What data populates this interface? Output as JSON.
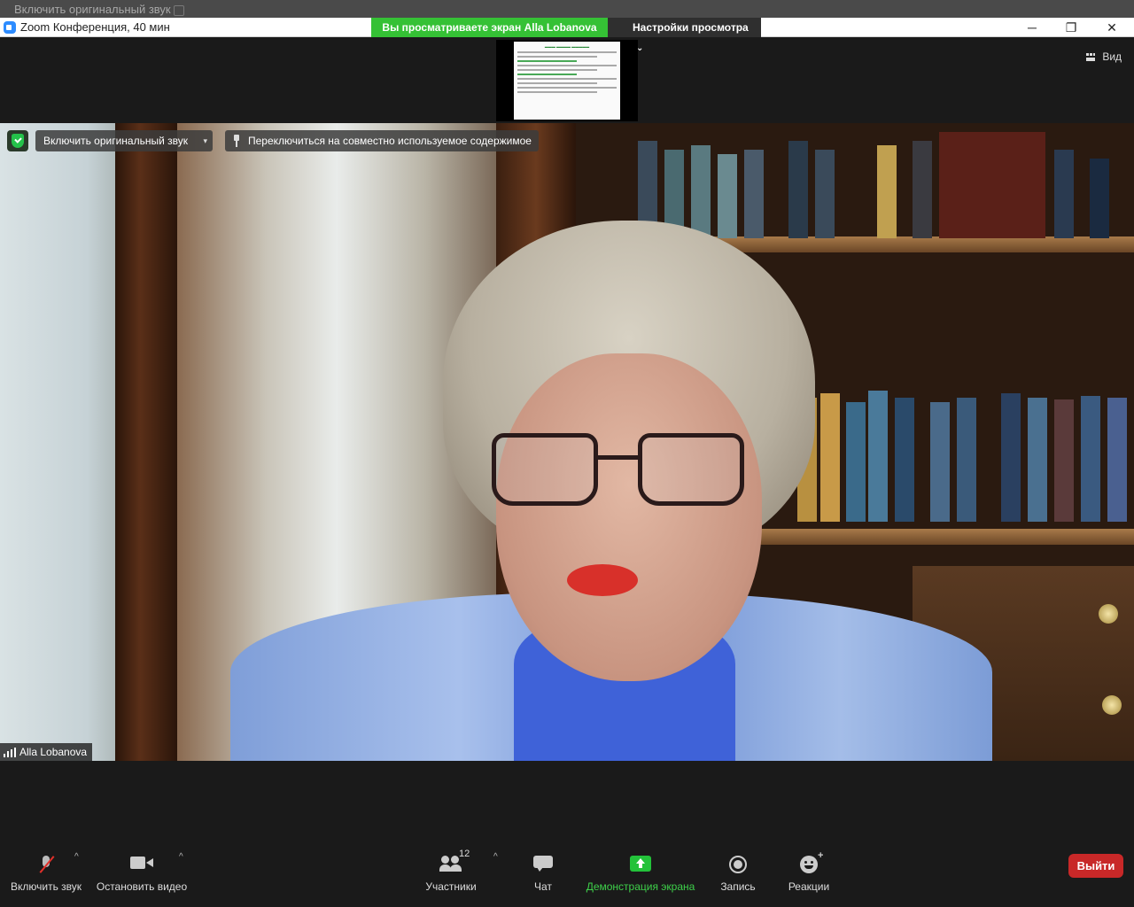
{
  "ghost": {
    "text": "Включить оригинальный звук"
  },
  "titlebar": {
    "title": "Zoom Конференция, 40 мин",
    "minimize": "─",
    "restore": "❐",
    "close": "✕"
  },
  "share_banner": {
    "viewing": "Вы просматриваете экран Alla Lobanova",
    "view_settings": "Настройки просмотра",
    "chevron": "⌄"
  },
  "view_button": {
    "label": "Вид"
  },
  "video_overlay": {
    "original_sound": "Включить оригинальный звук",
    "original_sound_dropdown": "▾",
    "switch_to_shared": "Переключиться на совместно используемое содержимое",
    "participant_name": "Alla Lobanova"
  },
  "toolbar": {
    "unmute": "Включить звук",
    "stop_video": "Остановить видео",
    "participants": "Участники",
    "participants_count": "12",
    "chat": "Чат",
    "share_screen": "Демонстрация экрана",
    "record": "Запись",
    "reactions": "Реакции",
    "caret": "^",
    "plus": "+",
    "leave": "Выйти"
  },
  "colors": {
    "share_green": "#35c135",
    "leave_red": "#c82828",
    "mute_slash": "#e0302a",
    "share_icon": "#23c23a"
  }
}
